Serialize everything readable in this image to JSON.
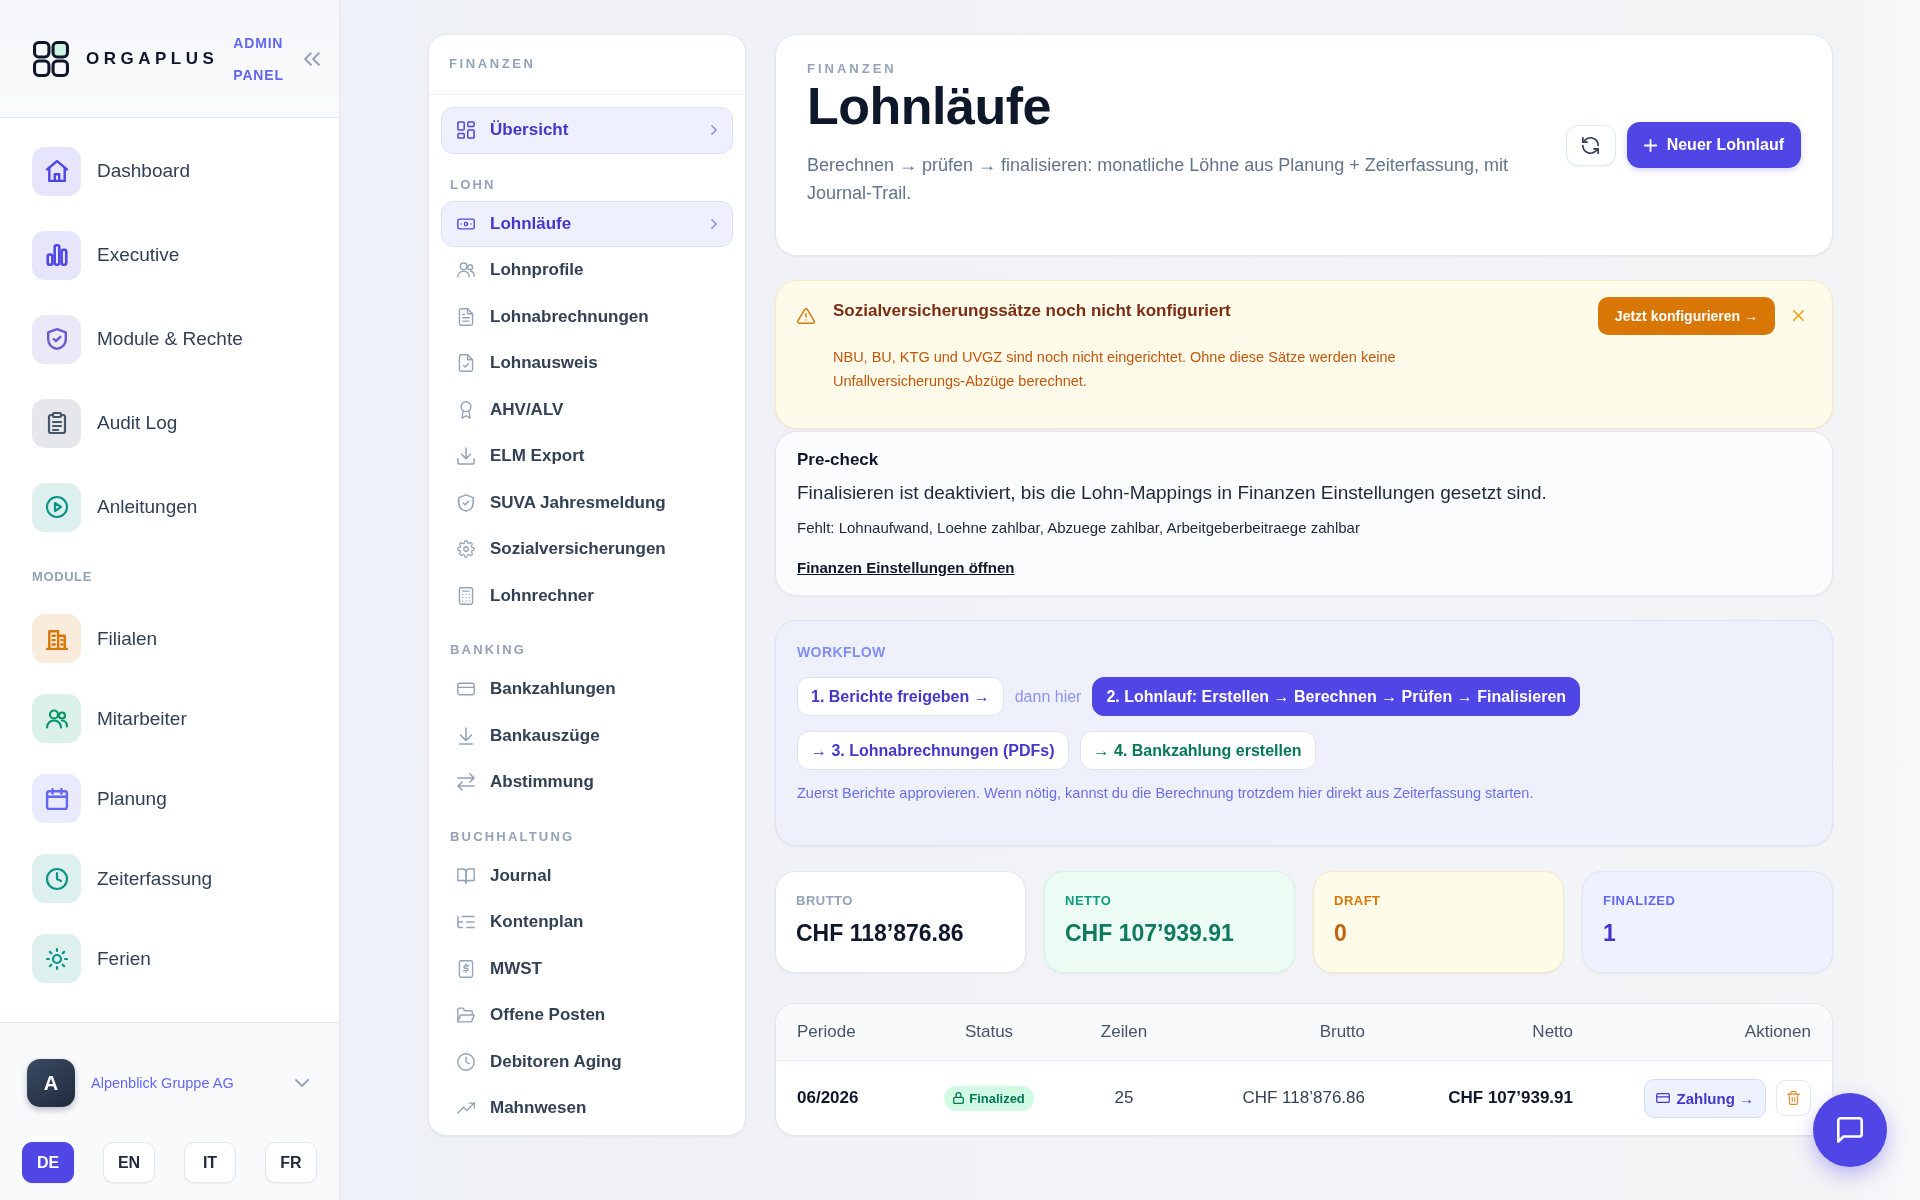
{
  "sidebar": {
    "brand": {
      "name": "ORGAPLUS",
      "tagline": "ADMIN PANEL"
    },
    "sections": [
      {
        "items": [
          {
            "label": "Dashboard",
            "color": "#4f46e5"
          },
          {
            "label": "Executive",
            "color": "#4f46e5"
          },
          {
            "label": "Module & Rechte",
            "color": "#6d5bd0"
          },
          {
            "label": "Audit Log",
            "color": "#475569"
          },
          {
            "label": "Anleitungen",
            "color": "#0d9488"
          }
        ]
      },
      {
        "title": "MODULE",
        "items": [
          {
            "label": "Filialen",
            "color": "#d97706"
          },
          {
            "label": "Mitarbeiter",
            "color": "#059669"
          },
          {
            "label": "Planung",
            "color": "#6366f1"
          },
          {
            "label": "Zeiterfassung",
            "color": "#0d9488"
          },
          {
            "label": "Ferien",
            "color": "#0d9488"
          }
        ]
      }
    ],
    "account": {
      "initial": "A",
      "name": "Alpenblick Gruppe AG"
    },
    "languages": [
      {
        "label": "DE",
        "selected": true
      },
      {
        "label": "EN",
        "selected": false
      },
      {
        "label": "IT",
        "selected": false
      },
      {
        "label": "FR",
        "selected": false
      }
    ]
  },
  "finance_nav": {
    "title": "FINANZEN",
    "groups": [
      {
        "items": [
          {
            "label": "Übersicht",
            "selected": true
          }
        ]
      },
      {
        "title": "LOHN",
        "items": [
          {
            "label": "Lohnläufe",
            "selected": true
          },
          {
            "label": "Lohnprofile",
            "selected": false
          },
          {
            "label": "Lohnabrechnungen",
            "selected": false
          },
          {
            "label": "Lohnausweis",
            "selected": false
          },
          {
            "label": "AHV/ALV",
            "selected": false
          },
          {
            "label": "ELM Export",
            "selected": false
          },
          {
            "label": "SUVA Jahresmeldung",
            "selected": false
          },
          {
            "label": "Sozialversicherungen",
            "selected": false
          },
          {
            "label": "Lohnrechner",
            "selected": false
          }
        ]
      },
      {
        "title": "BANKING",
        "items": [
          {
            "label": "Bankzahlungen",
            "selected": false
          },
          {
            "label": "Bankauszüge",
            "selected": false
          },
          {
            "label": "Abstimmung",
            "selected": false
          }
        ]
      },
      {
        "title": "BUCHHALTUNG",
        "items": [
          {
            "label": "Journal",
            "selected": false
          },
          {
            "label": "Kontenplan",
            "selected": false
          },
          {
            "label": "MWST",
            "selected": false
          },
          {
            "label": "Offene Posten",
            "selected": false
          },
          {
            "label": "Debitoren Aging",
            "selected": false
          },
          {
            "label": "Mahnwesen",
            "selected": false
          }
        ]
      }
    ]
  },
  "header": {
    "eyebrow": "FINANZEN",
    "title": "Lohnläufe",
    "description": "Berechnen → prüfen → finalisieren: monatliche Löhne aus Planung + Zeiterfassung, mit Journal-Trail.",
    "primary_button": "Neuer Lohnlauf"
  },
  "alert": {
    "title": "Sozialversicherungssätze noch nicht konfiguriert",
    "message": "NBU, BU, KTG und UVGZ sind noch nicht eingerichtet. Ohne diese Sätze werden keine Unfallversicherungs-Abzüge berechnet.",
    "action": "Jetzt konfigurieren →"
  },
  "precheck": {
    "title": "Pre-check",
    "message": "Finalisieren ist deaktiviert, bis die Lohn-Mappings in Finanzen Einstellungen gesetzt sind.",
    "missing": "Fehlt: Lohnaufwand, Loehne zahlbar, Abzuege zahlbar, Arbeitgeberbeitraege zahlbar",
    "link": "Finanzen Einstellungen öffnen"
  },
  "workflow": {
    "title": "WORKFLOW",
    "steps": [
      {
        "kind": "step",
        "label": "1. Berichte freigeben →",
        "selected": false,
        "color": "#4338ca"
      },
      {
        "kind": "text",
        "label": "dann hier"
      },
      {
        "kind": "step",
        "label": "2. Lohnlauf: Erstellen → Berechnen → Prüfen → Finalisieren",
        "selected": true,
        "color": "#4f46e5"
      },
      {
        "kind": "step",
        "label": "→ 3. Lohnabrechnungen (PDFs)",
        "selected": false,
        "color": "#4338ca"
      },
      {
        "kind": "step",
        "label": "→ 4. Bankzahlung erstellen",
        "selected": false,
        "color": "#047857"
      }
    ],
    "note": "Zuerst Berichte approvieren. Wenn nötig, kannst du die Berechnung trotzdem hier direkt aus Zeiterfassung starten."
  },
  "stats": [
    {
      "label": "BRUTTO",
      "value": "CHF 118’876.86",
      "kind": "neutral"
    },
    {
      "label": "NETTO",
      "value": "CHF 107’939.91",
      "kind": "success"
    },
    {
      "label": "DRAFT",
      "value": "0",
      "kind": "warning"
    },
    {
      "label": "FINALIZED",
      "value": "1",
      "kind": "info"
    }
  ],
  "table": {
    "columns": [
      "Periode",
      "Status",
      "Zeilen",
      "Brutto",
      "Netto",
      "Aktionen"
    ],
    "rows": [
      {
        "period": "06/2026",
        "status": "Finalized",
        "lines": "25",
        "gross": "CHF 118’876.86",
        "net": "CHF 107’939.91",
        "payment_action": "Zahlung →"
      }
    ]
  }
}
